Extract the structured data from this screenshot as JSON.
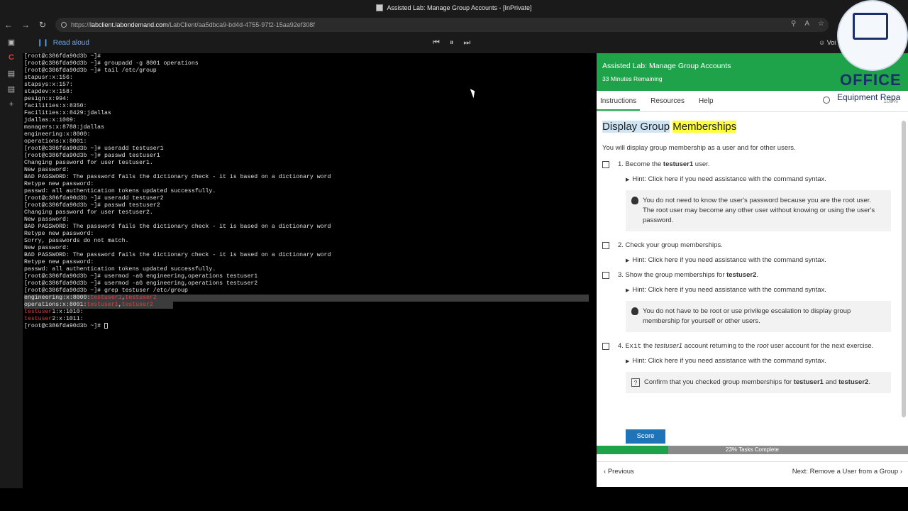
{
  "window": {
    "title": "Assisted Lab: Manage Group Accounts - [InPrivate]"
  },
  "browser": {
    "url_prefix": "https://",
    "url_host": "labclient.labondemand.com",
    "url_path": "/LabClient/aa5dbca9-bd4d-4755-97f2-15aa92ef308f"
  },
  "labbar": {
    "read_aloud": "Read aloud",
    "voice": "Voi"
  },
  "terminal": {
    "lines": [
      "[root@c386fda90d3b ~]#",
      "[root@c386fda90d3b ~]# groupadd -g 8001 operations",
      "[root@c386fda90d3b ~]# tail /etc/group",
      "stapusr:x:156:",
      "stapsys:x:157:",
      "stapdev:x:158:",
      "pesign:x:994:",
      "facilities:x:8350:",
      "Facilities:x:8429:jdallas",
      "jdallas:x:1009:",
      "managers:x:8788:jdallas",
      "engineering:x:8000:",
      "operations:x:8001:",
      "[root@c386fda90d3b ~]# useradd testuser1",
      "[root@c386fda90d3b ~]# passwd testuser1",
      "Changing password for user testuser1.",
      "New password:",
      "BAD PASSWORD: The password fails the dictionary check - it is based on a dictionary word",
      "Retype new password:",
      "passwd: all authentication tokens updated successfully.",
      "[root@c386fda90d3b ~]# useradd testuser2",
      "[root@c386fda90d3b ~]# passwd testuser2",
      "Changing password for user testuser2.",
      "New password:",
      "BAD PASSWORD: The password fails the dictionary check - it is based on a dictionary word",
      "Retype new password:",
      "Sorry, passwords do not match.",
      "New password:",
      "BAD PASSWORD: The password fails the dictionary check - it is based on a dictionary word",
      "Retype new password:",
      "passwd: all authentication tokens updated successfully.",
      "[root@c386fda90d3b ~]# usermod -aG engineering,operations testuser1",
      "[root@c386fda90d3b ~]# usermod -aG engineering,operations testuser2",
      "[root@c386fda90d3b ~]# grep testuser /etc/group"
    ],
    "grep_results": {
      "eng_prefix": "engineering:x:8000:",
      "ops_prefix": "operations:x:8001:",
      "u1": "testuser1",
      "u2": "testuser2",
      "comma": ",",
      "tu1_match": "testuser",
      "tu1_rest": "1:x:1010:",
      "tu2_match": "testuser",
      "tu2_rest": "2:x:1011:"
    },
    "prompt": "[root@c386fda90d3b ~]# "
  },
  "panel": {
    "title": "Assisted Lab: Manage Group Accounts",
    "remaining": "33 Minutes Remaining",
    "tabs": [
      "Instructions",
      "Resources",
      "Help"
    ],
    "zoom": "100%",
    "heading_part1": "Display Group",
    "heading_part2": "Memberships",
    "intro": "You will display group membership as a user and for other users.",
    "hint": "Hint: Click here if you need assistance with the command syntax.",
    "task1_pre": "1. Become the ",
    "task1_bold": "testuser1",
    "task1_post": " user.",
    "note1": "You do not need to know the user's password because you are the root user. The root user may become any other user without knowing or using the user's password.",
    "task2": "2. Check your group memberships.",
    "task3_pre": "3. Show the group memberships for ",
    "task3_bold": "testuser2",
    "task3_post": ".",
    "note2": "You do not have to be root or use privilege escalation to display group membership for yourself or other users.",
    "task4_num": "4. ",
    "task4_cmd": "Exit",
    "task4_a": " the ",
    "task4_i1": "testuser1",
    "task4_b": " account returning to the ",
    "task4_i2": "root",
    "task4_c": " user account for the next exercise.",
    "confirm_pre": "Confirm that you checked group memberships for ",
    "confirm_b1": "testuser1",
    "confirm_mid": " and ",
    "confirm_b2": "testuser2",
    "confirm_post": ".",
    "score": "Score",
    "progress_percent": 23,
    "progress_text": "23% Tasks Complete",
    "previous": "Previous",
    "next": "Next: Remove a User from a Group"
  },
  "watermark": {
    "line1": "OFFICE",
    "line2": "Equipment Repa"
  },
  "colors": {
    "accent_green": "#1fa34a",
    "score_blue": "#1f74b8",
    "terminal_red": "#d94242"
  }
}
